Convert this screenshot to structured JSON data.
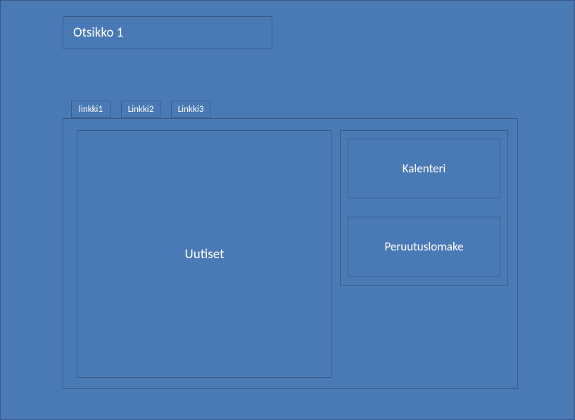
{
  "title": "Otsikko 1",
  "tabs": [
    {
      "label": "linkki1"
    },
    {
      "label": "Linkki2"
    },
    {
      "label": "Linkki3"
    }
  ],
  "main": {
    "news_label": "Uutiset"
  },
  "sidebar": {
    "calendar_label": "Kalenteri",
    "cancel_form_label": "Peruutuslomake"
  }
}
